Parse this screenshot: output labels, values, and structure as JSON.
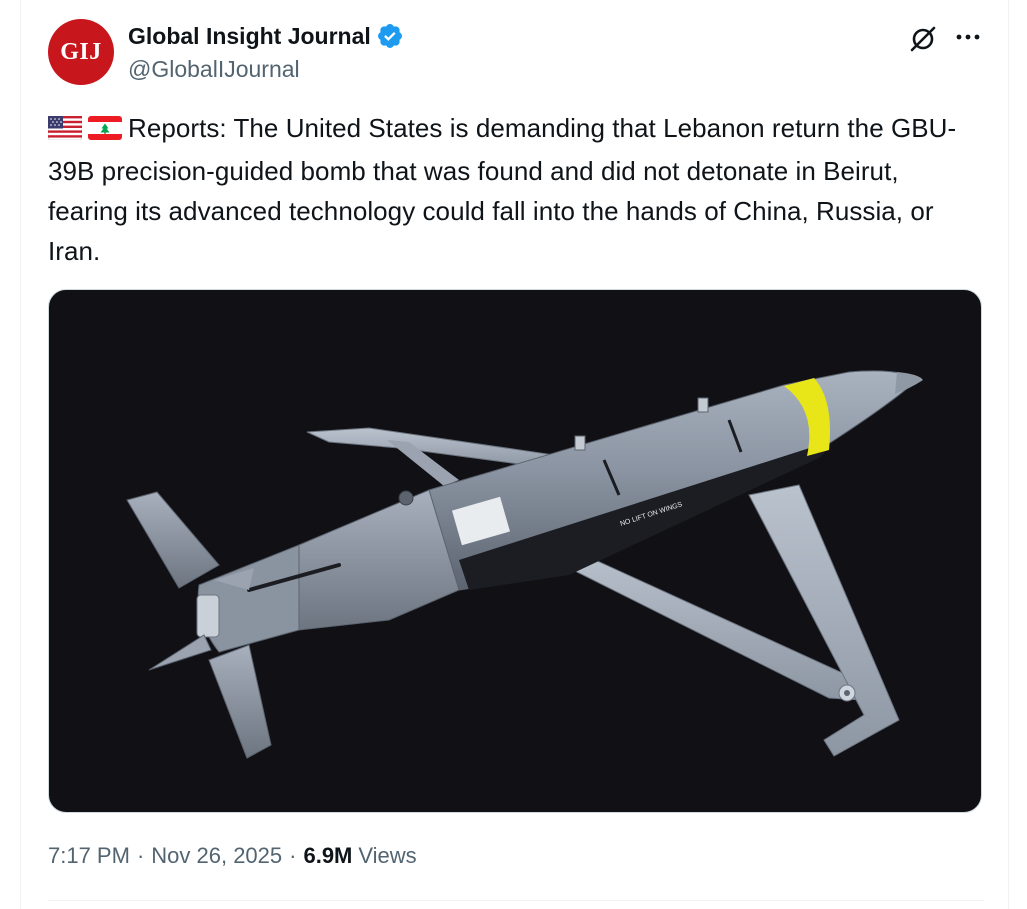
{
  "author": {
    "avatar_text": "GIJ",
    "display_name": "Global Insight Journal",
    "handle": "@GlobalIJournal",
    "verified": true
  },
  "actions": {
    "grok_icon": "grok-icon",
    "more_icon": "more-horizontal-icon"
  },
  "tweet": {
    "flags": [
      "us-flag-icon",
      "lebanon-flag-icon"
    ],
    "text": "Reports: The United States is demanding that Lebanon return the GBU-39B precision-guided bomb that was found and did not detonate in Beirut, fearing its advanced technology could fall into the hands of China, Russia, or Iran."
  },
  "media": {
    "bomb_marking": "NO LIFT ON WINGS"
  },
  "meta": {
    "time": "7:17 PM",
    "separator": "·",
    "date": "Nov 26, 2025",
    "views_count": "6.9M",
    "views_label": "Views"
  },
  "colors": {
    "avatar_bg": "#c8161d",
    "verified_blue": "#1d9bf0",
    "text_primary": "#0f1419",
    "text_secondary": "#536471",
    "media_bg": "#111115"
  }
}
